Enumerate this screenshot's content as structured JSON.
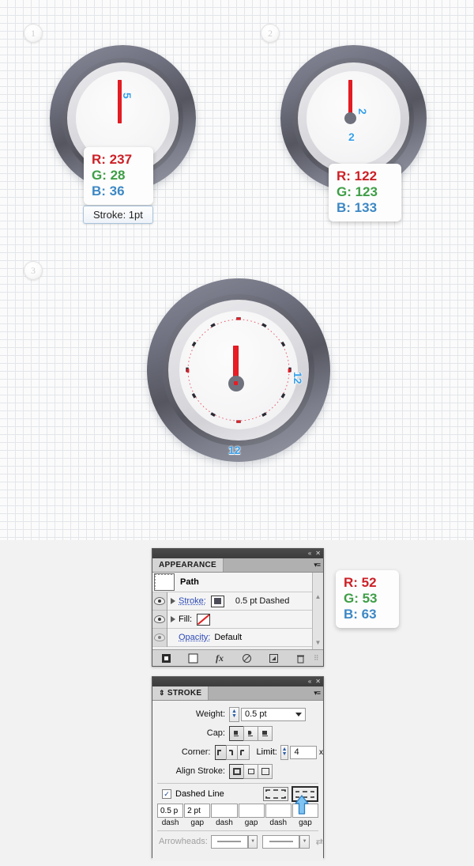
{
  "canvas": {
    "steps": [
      {
        "label": "1"
      },
      {
        "label": "2"
      },
      {
        "label": "3"
      }
    ],
    "clock1": {
      "hand_labels": [
        "5"
      ],
      "rgb": {
        "r": "R: 237",
        "g": "G: 28",
        "b": "B: 36"
      },
      "stroke_note": "Stroke: 1pt"
    },
    "clock2": {
      "hand_labels": [
        "2",
        "2"
      ],
      "rgb": {
        "r": "R: 122",
        "g": "G: 123",
        "b": "B: 133"
      }
    },
    "clock3": {
      "hand_labels": [
        "12",
        "12"
      ]
    }
  },
  "rgb_panel": {
    "r": "R: 52",
    "g": "G: 53",
    "b": "B: 63"
  },
  "appearance": {
    "tab_label": "APPEARANCE",
    "collapse_icon": "«",
    "close_icon": "✕",
    "menu_icon": "▾≡",
    "item_title": "Path",
    "rows": [
      {
        "label": "Stroke:",
        "value": "0.5 pt Dashed"
      },
      {
        "label": "Fill:",
        "value": ""
      },
      {
        "label": "Opacity:",
        "value": "Default"
      }
    ],
    "footer_icons": [
      "new-stroke-icon",
      "new-fill-icon",
      "fx-icon",
      "clear-appearance-icon",
      "duplicate-icon",
      "delete-icon"
    ],
    "fx_label": "fx",
    "scroll_up": "▲",
    "scroll_down": "▼"
  },
  "stroke_panel": {
    "tab_label": "STROKE",
    "tab_prefix": "⇕",
    "collapse_icon": "«",
    "close_icon": "✕",
    "menu_icon": "▾≡",
    "weight_label": "Weight:",
    "weight_value": "0.5 pt",
    "cap_label": "Cap:",
    "corner_label": "Corner:",
    "limit_label": "Limit:",
    "limit_value": "4",
    "limit_unit": "x",
    "align_label": "Align Stroke:",
    "dashed_label": "Dashed Line",
    "dashed_checked": "✓",
    "dash_values": [
      "0.5 p",
      "2 pt",
      "",
      "",
      "",
      ""
    ],
    "dash_captions": [
      "dash",
      "gap",
      "dash",
      "gap",
      "dash",
      "gap"
    ],
    "arrowheads_label": "Arrowheads:"
  },
  "colors": {
    "red": "#e81c24",
    "blue_label": "#3aa0e8",
    "ring_dark": "#55565f",
    "face": "#f6f6f7"
  }
}
